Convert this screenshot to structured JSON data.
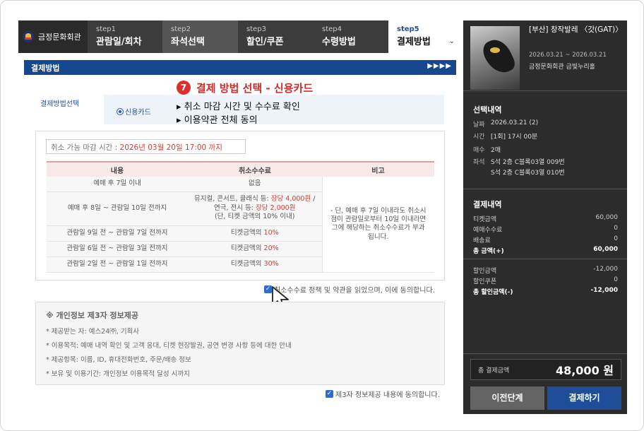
{
  "header": {
    "logo": "금정문화회관",
    "steps": [
      {
        "num": "step1",
        "label": "관람일/회차"
      },
      {
        "num": "step2",
        "label": "좌석선택"
      },
      {
        "num": "step3",
        "label": "할인/쿠폰"
      },
      {
        "num": "step4",
        "label": "수령방법"
      },
      {
        "num": "step5",
        "label": "결제방법"
      }
    ],
    "chevron": "⌄"
  },
  "section": {
    "title": "결제방법",
    "arrows": "▶▶▶▶"
  },
  "annotation": {
    "number": "7",
    "title": "결제 방법 선택 - 신용카드",
    "notes": [
      "▸ 취소 마감 시간 및 수수료 확인",
      "▸ 이용약관 전체 동의"
    ]
  },
  "payment": {
    "label": "결제방법선택",
    "option": "신용카드"
  },
  "cancel": {
    "deadline_prefix": "취소 가능 마감 시간 : ",
    "deadline_value": "2026년 03월 20일 17:00 까지",
    "headers": [
      "내용",
      "취소수수료",
      "비고"
    ],
    "rows": [
      {
        "period": "예매 후 7일 이내",
        "fee": "없음"
      },
      {
        "period": "예매 후 8일 ~ 관람일 10일 전까지",
        "fee_line1_a": "뮤지컬, 콘서트, 클래식 등: ",
        "fee_line1_b": "장당 4,000원",
        "fee_line1_c": " /",
        "fee_line2_a": "연극, 전시 등: ",
        "fee_line2_b": "장당 2,000원",
        "fee_line3": "(단, 티켓 금액의 10% 이내)"
      },
      {
        "period": "관람일 9일 전 ~ 관람일 7일 전까지",
        "fee_a": "티켓금액의 ",
        "fee_b": "10%"
      },
      {
        "period": "관람일 6일 전 ~ 관람일 3일 전까지",
        "fee_a": "티켓금액의 ",
        "fee_b": "20%"
      },
      {
        "period": "관람일 2일 전 ~ 관람일 1일 전까지",
        "fee_a": "티켓금액의 ",
        "fee_b": "30%"
      }
    ],
    "note": "- 단, 예매 후 7일 이내라도 취소시점이 관람일로부터 10일 이내라면 그에 해당하는 취소수수료가 부과됩니다.",
    "agree": "취소수수료 정책 및 약관을 읽었으며, 이에 동의합니다."
  },
  "privacy": {
    "title": "※ 개인정보 제3자 정보제공",
    "lines": [
      "* 제공받는 자: 예스24㈜, 기획사",
      "* 이용목적: 예매 내역 확인 및 고객 응대, 티켓 현장발권, 공연 변경 사항 등에 대한 안내",
      "* 제공항목: 이름, ID, 휴대전화번호, 주문/배송 정보",
      "* 보유 및 이용기간: 개인정보 이용목적 달성 시까지"
    ],
    "agree": "제3자 정보제공 내용에 동의합니다."
  },
  "sidebar": {
    "show_title": "[부산] 창작발레 〈갓(GAT)〉",
    "show_dates": "2026.03.21 ~ 2026.03.21",
    "venue": "금정문화회관 금빛누리홀",
    "selection_title": "선택내역",
    "selection": [
      {
        "k": "날짜",
        "v": "2026.03.21 (2)"
      },
      {
        "k": "시간",
        "v": "[1회] 17시 00분"
      },
      {
        "k": "매수",
        "v": "2매"
      },
      {
        "k": "좌석",
        "v": "S석 2층 C블록03열 009번"
      },
      {
        "k": "",
        "v": "S석 2층 C블록03열 010번"
      }
    ],
    "payment_title": "결제내역",
    "amounts": [
      {
        "k": "티켓금액",
        "v": "60,000"
      },
      {
        "k": "예매수수료",
        "v": "0"
      },
      {
        "k": "배송료",
        "v": "0"
      },
      {
        "k": "총 금액(+)",
        "v": "60,000"
      }
    ],
    "discounts": [
      {
        "k": "할인금액",
        "v": "-12,000"
      },
      {
        "k": "할인쿠폰",
        "v": "0"
      },
      {
        "k": "총 할인금액(-)",
        "v": "-12,000"
      }
    ],
    "total_label": "총 결제금액",
    "total_value": "48,000 원",
    "prev_button": "이전단계",
    "pay_button": "결제하기"
  }
}
